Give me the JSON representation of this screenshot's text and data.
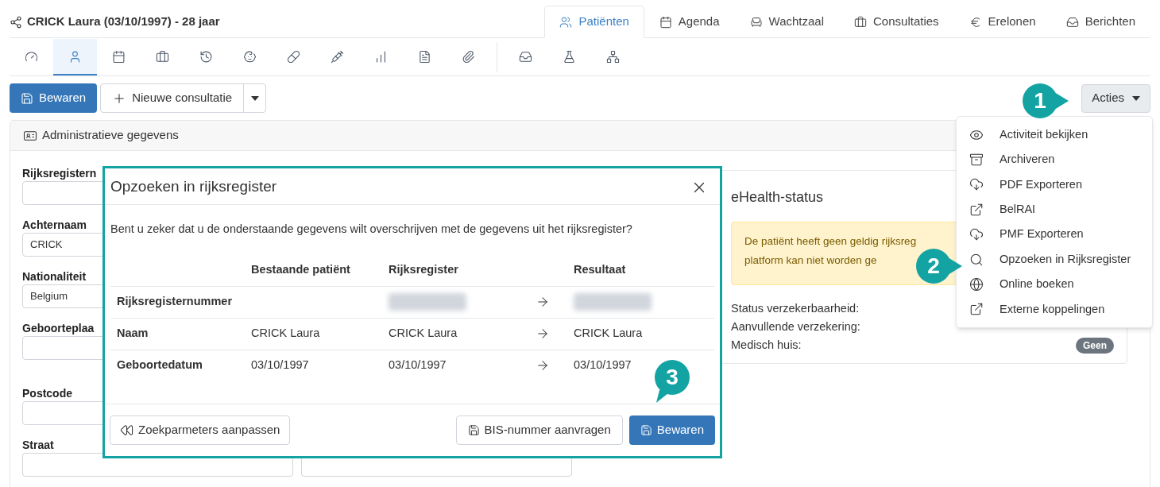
{
  "header": {
    "title": "CRICK Laura (03/10/1997) - 28 jaar"
  },
  "nav_tabs": [
    {
      "label": "Patiënten",
      "selected": true
    },
    {
      "label": "Agenda",
      "selected": false
    },
    {
      "label": "Wachtzaal",
      "selected": false
    },
    {
      "label": "Consultaties",
      "selected": false
    },
    {
      "label": "Erelonen",
      "selected": false
    },
    {
      "label": "Berichten",
      "selected": false
    }
  ],
  "tool_tabs": {
    "primary": [
      {
        "selected": false
      },
      {
        "selected": true
      },
      {
        "selected": false
      },
      {
        "selected": false
      },
      {
        "selected": false
      },
      {
        "selected": false
      },
      {
        "selected": false
      },
      {
        "selected": false
      },
      {
        "selected": false
      },
      {
        "selected": false
      },
      {
        "selected": false
      }
    ],
    "secondary": [
      {
        "selected": false
      },
      {
        "selected": false
      },
      {
        "selected": false
      }
    ]
  },
  "toolbar": {
    "save_button": "Bewaren",
    "new_consultation_button": "Nieuwe consultatie",
    "actions_button": "Acties"
  },
  "actions_menu": {
    "open": true,
    "items": [
      "Activiteit bekijken",
      "Archiveren",
      "PDF Exporteren",
      "BelRAI",
      "PMF Exporteren",
      "Opzoeken in Rijksregister",
      "Online boeken",
      "Externe koppelingen"
    ]
  },
  "panel": {
    "title": "Administratieve gegevens"
  },
  "form": {
    "fields": [
      {
        "label": "Rijksregistern"
      },
      {
        "label": "Achternaam",
        "value": "CRICK"
      },
      {
        "label": "Nationaliteit",
        "value": "Belgium"
      },
      {
        "label": "Geboorteplaa"
      },
      {
        "label": "Postcode"
      },
      {
        "label": "Straat"
      }
    ]
  },
  "ehealth": {
    "title": "eHealth-status",
    "warning": [
      "De patiënt heeft geen geldig rijksreg",
      "platform kan niet worden ge"
    ],
    "statuses": [
      {
        "label": "Status verzekerbaarheid:"
      },
      {
        "label": "Aanvullende verzekering:"
      },
      {
        "label": "Medisch huis:",
        "badge": "Geen"
      }
    ]
  },
  "modal": {
    "title": "Opzoeken in rijksregister",
    "question": "Bent u zeker dat u de onderstaande gegevens wilt overschrijven met de gegevens uit het rijksregister?",
    "columns": [
      "Bestaande patiënt",
      "Rijksregister",
      "Resultaat"
    ],
    "rows": [
      {
        "label": "Rijksregisternummer",
        "redacted": true
      },
      {
        "label": "Naam",
        "existing": "CRICK Laura",
        "registry": "CRICK Laura",
        "result": "CRICK Laura"
      },
      {
        "label": "Geboortedatum",
        "existing": "03/10/1997",
        "registry": "03/10/1997",
        "result": "03/10/1997"
      }
    ],
    "back_button": "Zoekparmeters aanpassen",
    "bis_button": "BIS-nummer aanvragen",
    "save_button": "Bewaren"
  },
  "callouts": [
    {
      "label": "1"
    },
    {
      "label": "2"
    },
    {
      "label": "3"
    }
  ]
}
